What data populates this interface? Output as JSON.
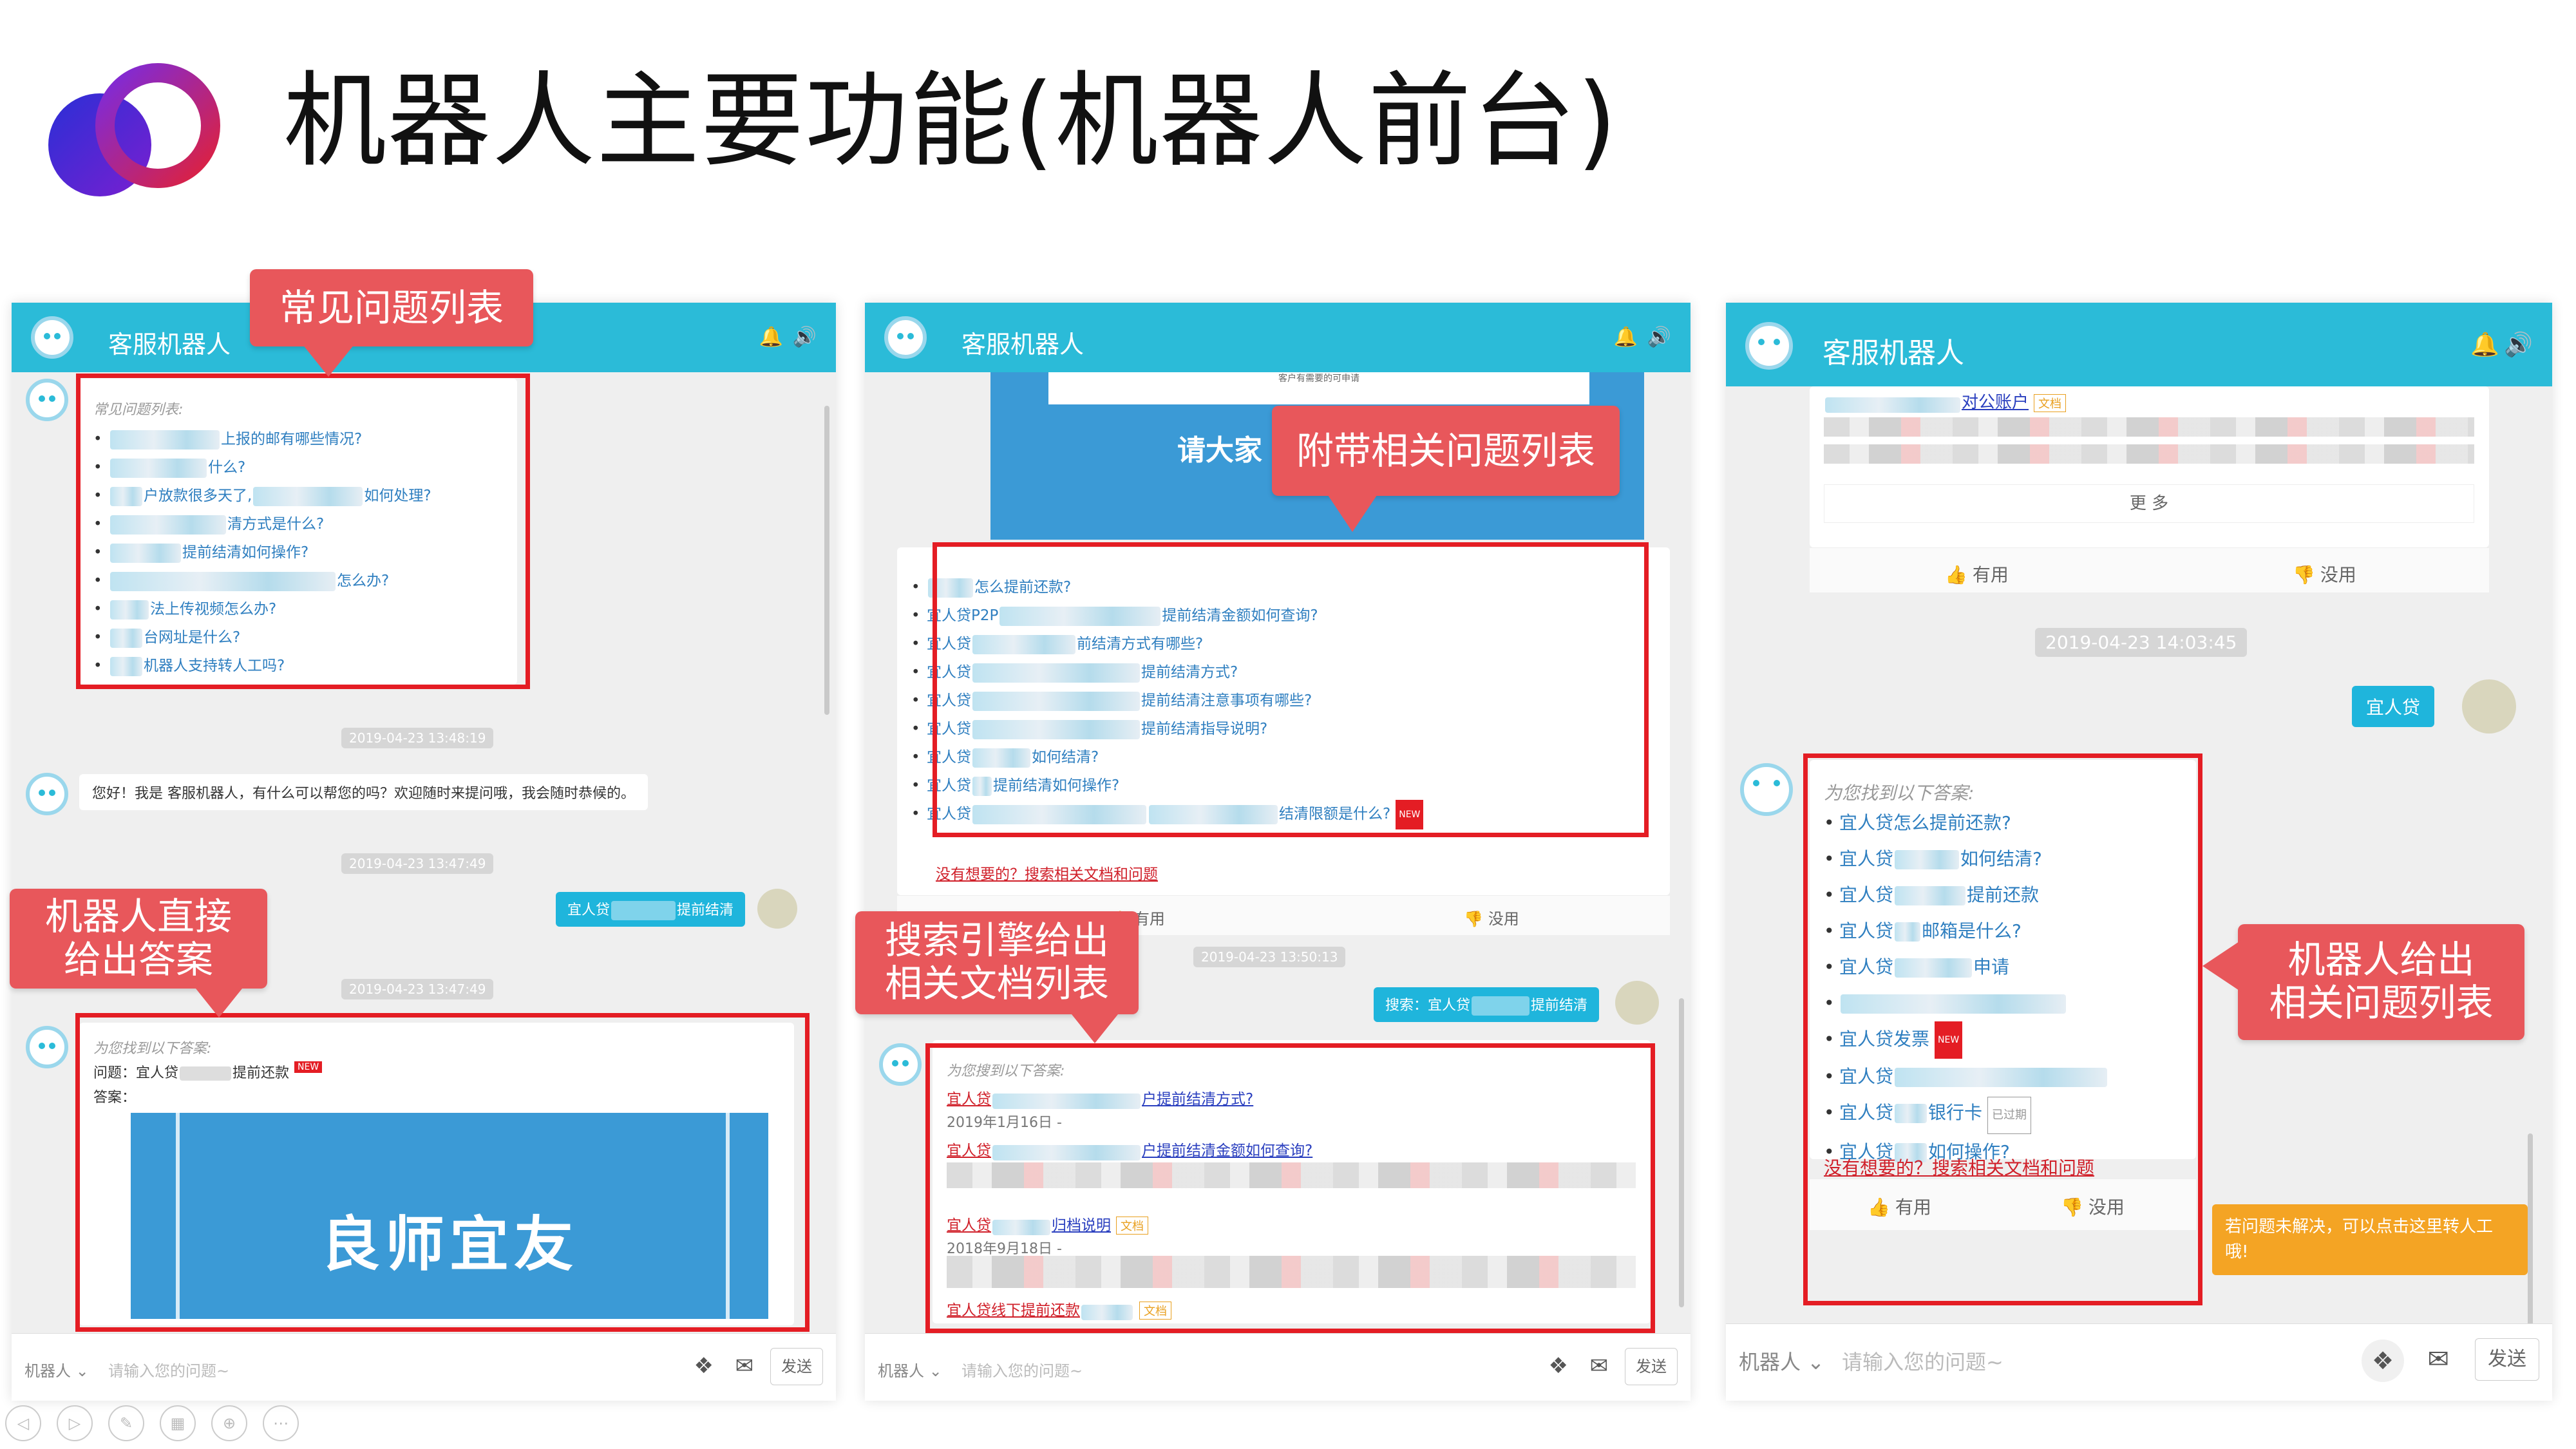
{
  "slide": {
    "title": "机器人主要功能(机器人前台)"
  },
  "colors": {
    "header": "#2bbbd8",
    "highlight_red": "#e41d24",
    "callout": "#e8575b",
    "link_blue": "#2f7fc0",
    "tooltip": "#f4a424"
  },
  "panel1": {
    "header_title": "客服机器人",
    "faq_title": "常见问题列表:",
    "faq_items": [
      "上报的邮有哪些情况?",
      "什么?",
      "户放款很多天了,",
      "如何处理?",
      "清方式是什么?",
      "提前结清如何操作?",
      "怎么办?",
      "法上传视频怎么办?",
      "台网址是什么?",
      "机器人支持转人工吗?"
    ],
    "ts1": "2019-04-23 13:48:19",
    "greeting": "您好！我是      客服机器人，有什么可以帮您的吗？欢迎随时来提问哦，我会随时恭候的。",
    "ts2": "2019-04-23 13:47:49",
    "user_msg_a": "宜人贷",
    "user_msg_b": "提前结清",
    "ts3": "2019-04-23 13:47:49",
    "answer_title": "为您找到以下答案:",
    "q_label": "问题：",
    "q_a": "宜人贷",
    "q_b": "提前还款",
    "new_badge": "NEW",
    "a_label": "答案：",
    "banner_text": "良师宜友",
    "input_robot": "机器人 ⌄",
    "input_placeholder": "请输入您的问题~",
    "send": "发送"
  },
  "panel2": {
    "header_title": "客服机器人",
    "banner_text": "请大家",
    "banner_sub": "客户有需要的可申请",
    "items": [
      "怎么提前还款?",
      "宜人贷P2P",
      "提前结清金额如何查询?",
      "宜人贷",
      "前结清方式有哪些?",
      "提前结清方式?",
      "提前结清注意事项有哪些?",
      "提前结清指导说明?",
      "如何结清?",
      "提前结清如何操作?",
      "结清限额是什么?"
    ],
    "item_prefix": "宜人贷",
    "new_badge": "NEW",
    "nomatch": "没有想要的？搜索相关文档和问题",
    "useful": "有用",
    "useless": "没用",
    "ts": "2019-04-23 13:50:13",
    "user_msg_a": "搜索：宜人贷",
    "user_msg_b": "提前结清",
    "doc_title": "为您搜到以下答案:",
    "docs": [
      "户提前结清方式?",
      "2019年1月16日 -",
      "户提前结清金额如何查询?",
      "归档说明",
      "2018年9月18日 -",
      "线下提前还款"
    ],
    "doc_prefix": "宜人贷",
    "doc_tag": "文档",
    "input_robot": "机器人 ⌄",
    "input_placeholder": "请输入您的问题~",
    "send": "发送"
  },
  "panel3": {
    "header_title": "客服机器人",
    "top_link": "对公账户",
    "top_tag": "文档",
    "more": "更 多",
    "useful": "有用",
    "useless": "没用",
    "ts": "2019-04-23 14:03:45",
    "user_msg": "宜人贷",
    "answer_title": "为您找到以下答案:",
    "items": [
      "宜人贷怎么提前还款?",
      "宜人贷",
      "如何结清?",
      "提前还款",
      "邮箱是什么?",
      "申请",
      "宜人贷发票",
      "银行卡",
      "如何操作?"
    ],
    "item_prefix": "宜人贷",
    "new_badge": "NEW",
    "expired": "已过期",
    "nomatch": "没有想要的？搜索相关文档和问题",
    "tooltip": "若问题未解决，可以点击这里转人工哦!",
    "input_robot": "机器人 ⌄",
    "input_placeholder": "请输入您的问题~",
    "send": "发送"
  },
  "callouts": {
    "faq": "常见问题列表",
    "related": "附带相关问题列表",
    "direct_1": "机器人直接",
    "direct_2": "给出答案",
    "search_1": "搜索引擎给出",
    "search_2": "相关文档列表",
    "robot_list_1": "机器人给出",
    "robot_list_2": "相关问题列表"
  },
  "icons": [
    "bell-icon",
    "volume-icon",
    "apps-icon",
    "mail-icon",
    "thumb-up-icon",
    "thumb-down-icon",
    "robot-avatar-icon"
  ]
}
